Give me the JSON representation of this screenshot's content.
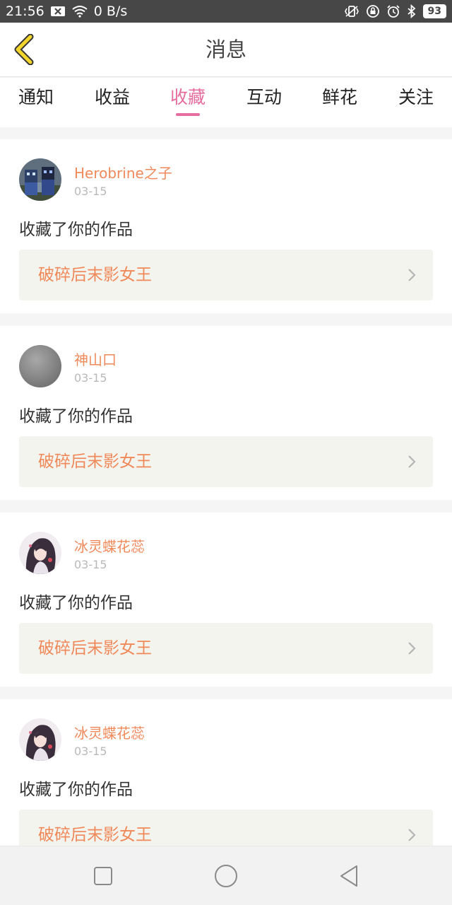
{
  "status_bar": {
    "time": "21:56",
    "network_speed": "0 B/s",
    "battery": "93",
    "icons": [
      "notification-x-icon",
      "wifi-icon",
      "vibrate-icon",
      "lock-rotation-icon",
      "alarm-icon",
      "bluetooth-icon",
      "battery-icon"
    ]
  },
  "header": {
    "title": "消息",
    "back_icon": "chevron-left-icon"
  },
  "tabs": [
    {
      "label": "通知",
      "active": false
    },
    {
      "label": "收益",
      "active": false
    },
    {
      "label": "收藏",
      "active": true
    },
    {
      "label": "互动",
      "active": false
    },
    {
      "label": "鲜花",
      "active": false
    },
    {
      "label": "关注",
      "active": false
    }
  ],
  "messages": [
    {
      "user": "Herobrine之子",
      "date": "03-15",
      "action": "收藏了你的作品",
      "work": "破碎后末影女王",
      "avatar": "minecraft-avatar"
    },
    {
      "user": "神山口",
      "date": "03-15",
      "action": "收藏了你的作品",
      "work": "破碎后末影女王",
      "avatar": "gray-avatar"
    },
    {
      "user": "冰灵蝶花蕊",
      "date": "03-15",
      "action": "收藏了你的作品",
      "work": "破碎后末影女王",
      "avatar": "anime-girl-avatar"
    },
    {
      "user": "冰灵蝶花蕊",
      "date": "03-15",
      "action": "收藏了你的作品",
      "work": "破碎后末影女王",
      "avatar": "anime-girl-avatar"
    }
  ],
  "nav_bar": {
    "icons": [
      "recent-apps-icon",
      "home-icon",
      "back-icon"
    ]
  },
  "colors": {
    "accent": "#e66d9f",
    "username": "#f0895a",
    "status_bar": "#474747",
    "back_icon": "#f2d62e"
  }
}
